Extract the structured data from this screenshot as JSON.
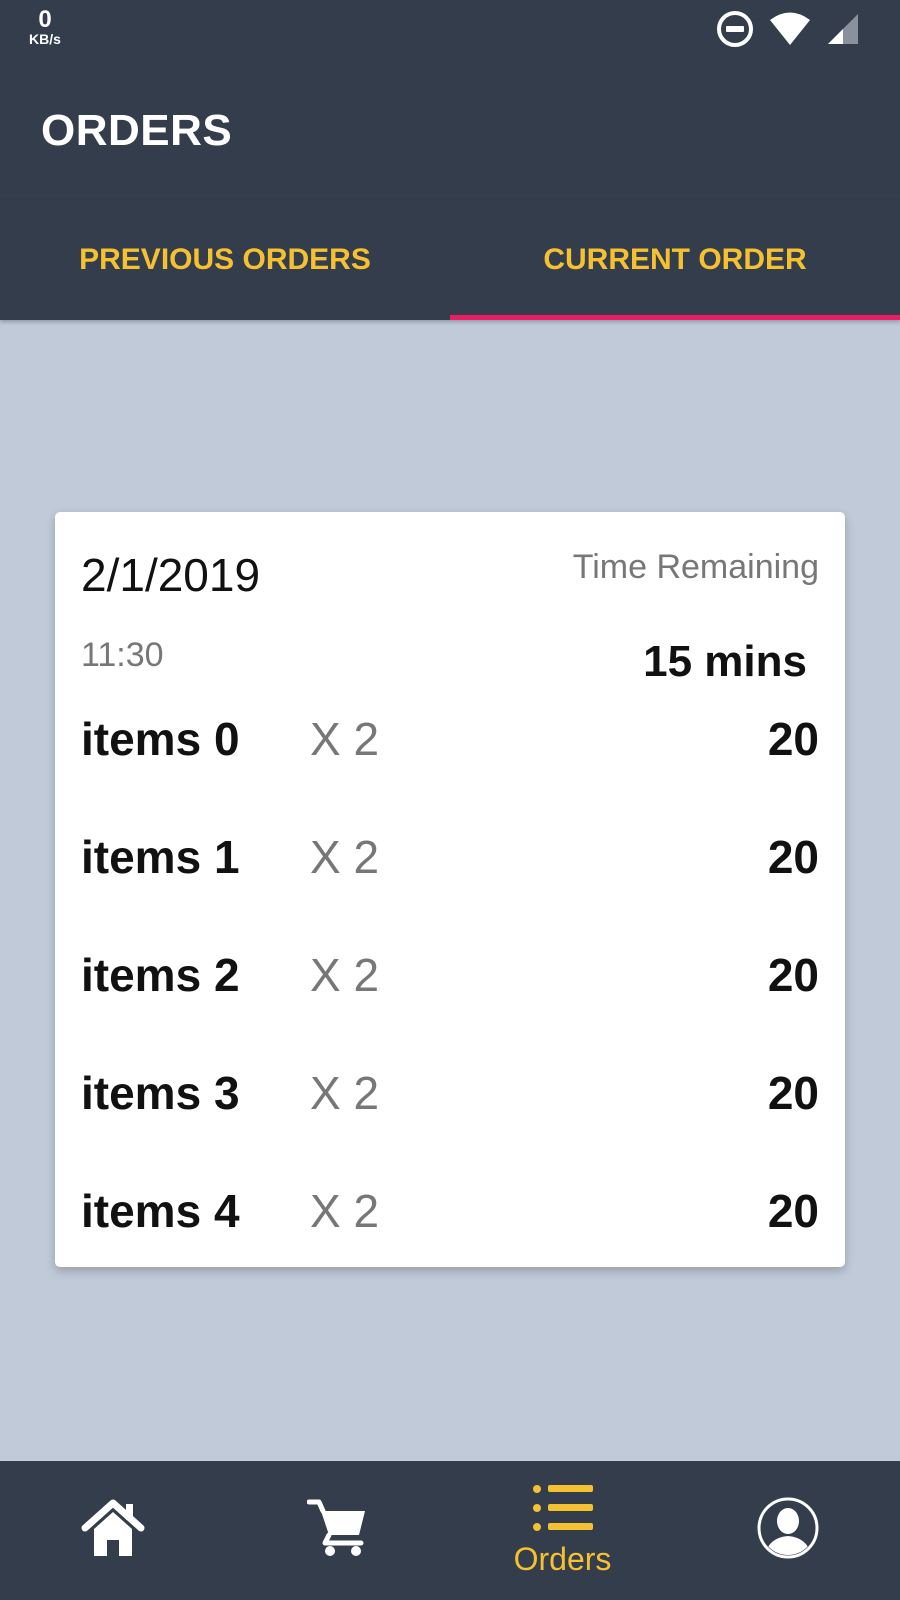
{
  "status_bar": {
    "net_speed_value": "0",
    "net_speed_unit": "KB/s",
    "icons": [
      "do-not-disturb-icon",
      "wifi-icon",
      "signal-icon"
    ]
  },
  "header": {
    "title": "ORDERS"
  },
  "tabs": [
    {
      "label": "PREVIOUS ORDERS",
      "active": false
    },
    {
      "label": "CURRENT ORDER",
      "active": true
    }
  ],
  "order": {
    "date": "2/1/2019",
    "time": "11:30",
    "time_remaining_label": "Time Remaining",
    "time_remaining_value": "15 mins",
    "items": [
      {
        "name": "items 0",
        "qty": "X 2",
        "price": "20"
      },
      {
        "name": "items 1",
        "qty": "X 2",
        "price": "20"
      },
      {
        "name": "items 2",
        "qty": "X 2",
        "price": "20"
      },
      {
        "name": "items 3",
        "qty": "X 2",
        "price": "20"
      },
      {
        "name": "items 4",
        "qty": "X 2",
        "price": "20"
      }
    ]
  },
  "bottom_nav": {
    "items": [
      {
        "icon": "home-icon",
        "label": ""
      },
      {
        "icon": "cart-icon",
        "label": ""
      },
      {
        "icon": "list-icon",
        "label": "Orders"
      },
      {
        "icon": "profile-icon",
        "label": ""
      }
    ]
  },
  "colors": {
    "bar_background": "#343d4b",
    "accent_yellow": "#f6c131",
    "tab_indicator": "#e91e63",
    "page_background": "#c0cad9"
  }
}
